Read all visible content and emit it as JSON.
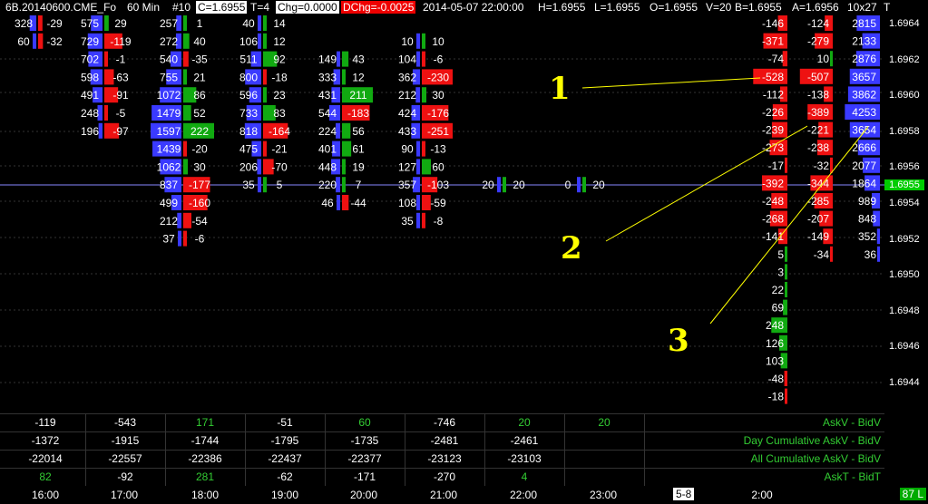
{
  "header": {
    "symbol": "6B.20140600.CME_Fo",
    "interval": "60 Min",
    "bars": "#10",
    "close": "C=1.6955",
    "ticks": "T=4",
    "chg": "Chg=0.0000",
    "dchg": "DChg=-0.0025",
    "datetime": "2014-05-07  22:00:00",
    "high": "H=1.6955",
    "low": "L=1.6955",
    "open": "O=1.6955",
    "volume": "V=20",
    "bid": "B=1.6955",
    "ask": "A=1.6956",
    "size": "10x27",
    "tag": "T"
  },
  "price_axis": {
    "labels": [
      "1.6964",
      "1.6962",
      "1.6960",
      "1.6958",
      "1.6956",
      "1.6954",
      "1.6952",
      "1.6950",
      "1.6948",
      "1.6946",
      "1.6944"
    ],
    "current": "1.6955"
  },
  "columns": [
    {
      "bid": [
        [
          "328",
          0
        ],
        [
          "60",
          1
        ]
      ],
      "ask": [
        [
          "-29",
          0
        ],
        [
          "-32",
          1
        ]
      ]
    },
    {
      "bid": [
        [
          "575",
          0
        ],
        [
          "729",
          1
        ],
        [
          "702",
          2
        ],
        [
          "598",
          3
        ],
        [
          "491",
          4
        ],
        [
          "248",
          5
        ],
        [
          "196",
          6
        ]
      ],
      "ask": [
        [
          "29",
          0
        ],
        [
          "-119",
          1
        ],
        [
          "-1",
          2
        ],
        [
          "-63",
          3
        ],
        [
          "-91",
          4
        ],
        [
          "-5",
          5
        ],
        [
          "-97",
          6
        ]
      ]
    },
    {
      "bid": [
        [
          "257",
          0
        ],
        [
          "272",
          1
        ],
        [
          "540",
          2
        ],
        [
          "755",
          3
        ],
        [
          "1072",
          4
        ],
        [
          "1479",
          5
        ],
        [
          "1597",
          6
        ],
        [
          "1439",
          7
        ],
        [
          "1062",
          8
        ],
        [
          "837",
          9
        ],
        [
          "499",
          10
        ],
        [
          "212",
          11
        ],
        [
          "37",
          12
        ]
      ],
      "ask": [
        [
          "1",
          0
        ],
        [
          "40",
          1
        ],
        [
          "-35",
          2
        ],
        [
          "21",
          3
        ],
        [
          "86",
          4
        ],
        [
          "52",
          5
        ],
        [
          "222",
          6
        ],
        [
          "-20",
          7
        ],
        [
          "30",
          8
        ],
        [
          "-177",
          9
        ],
        [
          "-160",
          10
        ],
        [
          "-54",
          11
        ],
        [
          "-6",
          12
        ]
      ]
    },
    {
      "bid": [
        [
          "40",
          0
        ],
        [
          "106",
          1
        ],
        [
          "511",
          2
        ],
        [
          "800",
          3
        ],
        [
          "596",
          4
        ],
        [
          "733",
          5
        ],
        [
          "818",
          6
        ],
        [
          "475",
          7
        ],
        [
          "206",
          8
        ],
        [
          "35",
          9
        ]
      ],
      "ask": [
        [
          "14",
          0
        ],
        [
          "12",
          1
        ],
        [
          "92",
          2
        ],
        [
          "-18",
          3
        ],
        [
          "23",
          4
        ],
        [
          "83",
          5
        ],
        [
          "-164",
          6
        ],
        [
          "-21",
          7
        ],
        [
          "-70",
          8
        ],
        [
          "5",
          9
        ]
      ]
    },
    {
      "bid": [
        [
          "149",
          2
        ],
        [
          "333",
          3
        ],
        [
          "431",
          4
        ],
        [
          "544",
          5
        ],
        [
          "224",
          6
        ],
        [
          "401",
          7
        ],
        [
          "448",
          8
        ],
        [
          "220",
          9
        ],
        [
          "46",
          10
        ]
      ],
      "ask": [
        [
          "43",
          2
        ],
        [
          "12",
          3
        ],
        [
          "211",
          4
        ],
        [
          "-183",
          5
        ],
        [
          "56",
          6
        ],
        [
          "61",
          7
        ],
        [
          "19",
          8
        ],
        [
          "7",
          9
        ],
        [
          "-44",
          10
        ]
      ]
    },
    {
      "bid": [
        [
          "10",
          1
        ],
        [
          "104",
          2
        ],
        [
          "362",
          3
        ],
        [
          "212",
          4
        ],
        [
          "424",
          5
        ],
        [
          "433",
          6
        ],
        [
          "90",
          7
        ],
        [
          "127",
          8
        ],
        [
          "357",
          9
        ],
        [
          "108",
          10
        ],
        [
          "35",
          11
        ]
      ],
      "ask": [
        [
          "10",
          1
        ],
        [
          "-6",
          2
        ],
        [
          "-230",
          3
        ],
        [
          "30",
          4
        ],
        [
          "-176",
          5
        ],
        [
          "-251",
          6
        ],
        [
          "-13",
          7
        ],
        [
          "60",
          8
        ],
        [
          "-103",
          9
        ],
        [
          "-59",
          10
        ],
        [
          "-8",
          11
        ]
      ]
    },
    {
      "bid": [
        [
          "20",
          9
        ]
      ],
      "ask": [
        [
          "20",
          9
        ]
      ]
    },
    {
      "bid": [
        [
          "0",
          9
        ]
      ],
      "ask": [
        [
          "20",
          9
        ]
      ]
    }
  ],
  "profile": {
    "c1": [
      "-146",
      "-371",
      "-74",
      "-528",
      "-112",
      "-226",
      "-239",
      "-273",
      "-17",
      "-392",
      "-248",
      "-268",
      "-141",
      "5",
      "3",
      "22",
      "69",
      "248",
      "126",
      "103",
      "-48",
      "-18"
    ],
    "c2": [
      "-124",
      "-279",
      "10",
      "-507",
      "-138",
      "-389",
      "-221",
      "-238",
      "-32",
      "-344",
      "-285",
      "-207",
      "-149",
      "-34"
    ],
    "c3": [
      "2815",
      "2133",
      "2876",
      "3657",
      "3862",
      "4253",
      "3654",
      "2666",
      "2077",
      "1864",
      "989",
      "848",
      "352",
      "36"
    ]
  },
  "annotations": [
    {
      "label": "1"
    },
    {
      "label": "2"
    },
    {
      "label": "3"
    }
  ],
  "panel": {
    "rows": [
      {
        "label": "AskV - BidV",
        "cells": [
          "-119",
          "-543",
          "171",
          "-51",
          "60",
          "-746",
          "20",
          "20"
        ]
      },
      {
        "label": "Day Cumulative AskV - BidV",
        "cells": [
          "-1372",
          "-1915",
          "-1744",
          "-1795",
          "-1735",
          "-2481",
          "-2461",
          ""
        ]
      },
      {
        "label": "All Cumulative AskV - BidV",
        "cells": [
          "-22014",
          "-22557",
          "-22386",
          "-22437",
          "-22377",
          "-23123",
          "-23103",
          ""
        ]
      },
      {
        "label": "AskT - BidT",
        "cells": [
          "82",
          "-92",
          "281",
          "-62",
          "-171",
          "-270",
          "4",
          ""
        ]
      }
    ]
  },
  "time_axis": {
    "labels": [
      "16:00",
      "17:00",
      "18:00",
      "19:00",
      "20:00",
      "21:00",
      "22:00",
      "23:00",
      "2:00"
    ],
    "badge": "5-8",
    "corner": "87 L"
  },
  "colors": {
    "bid": "#3a3aff",
    "ask_neg": "#e11",
    "ask_pos": "#1a1",
    "annotation": "#ff0",
    "grid": "#333"
  }
}
